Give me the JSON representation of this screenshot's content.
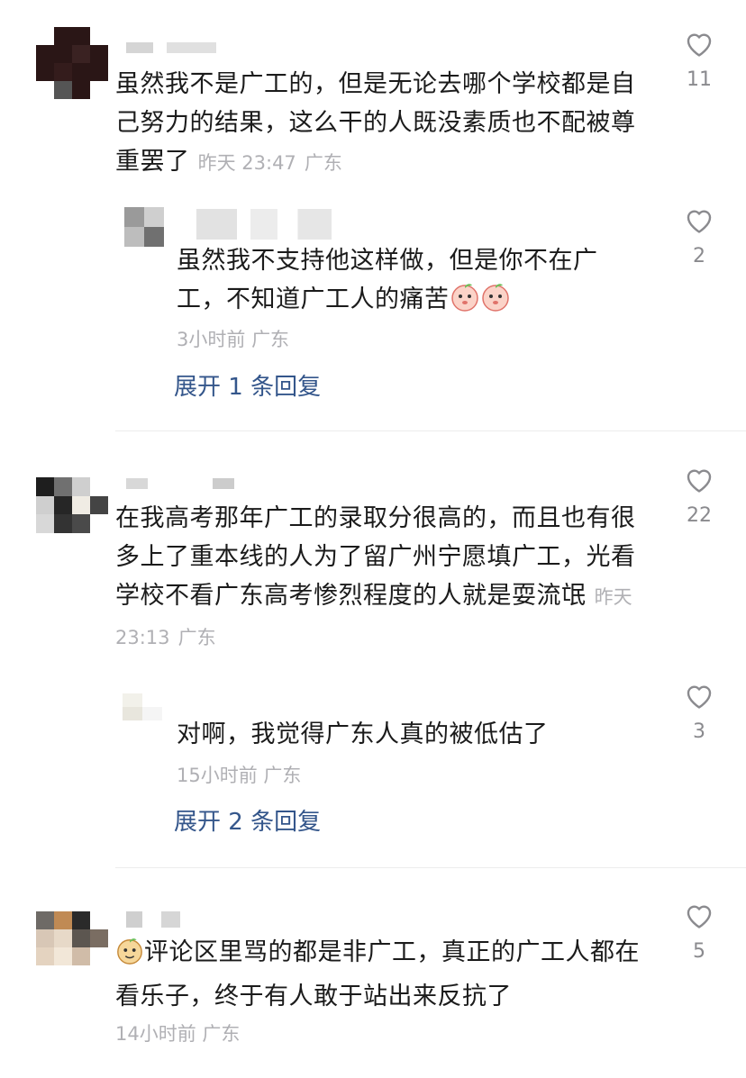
{
  "comments": [
    {
      "text": "虽然我不是广工的，但是无论去哪个学校都是自己努力的结果，这么干的人既没素质也不配被尊重罢了",
      "time": "昨天 23:47",
      "location": "广东",
      "likes": "11",
      "replies": [
        {
          "text": "虽然我不支持他这样做，但是你不在广工，不知道广工人的痛苦",
          "time": "3小时前",
          "location": "广东",
          "likes": "2"
        }
      ],
      "expand_label": "展开 1 条回复"
    },
    {
      "text": "在我高考那年广工的录取分很高的，而且也有很多上了重本线的人为了留广州宁愿填广工，光看学校不看广东高考惨烈程度的人就是耍流氓",
      "time": "昨天 23:13",
      "location": "广东",
      "likes": "22",
      "replies": [
        {
          "text": "对啊，我觉得广东人真的被低估了",
          "time": "15小时前",
          "location": "广东",
          "likes": "3"
        }
      ],
      "expand_label": "展开 2 条回复"
    },
    {
      "text": "评论区里骂的都是非广工，真正的广工人都在看乐子，终于有人敢于站出来反抗了",
      "time": "14小时前",
      "location": "广东",
      "likes": "5"
    }
  ],
  "icons": {
    "like": "heart-outline-icon",
    "emoji": "peach-emoji-icon"
  },
  "colors": {
    "text": "#1b1b1b",
    "meta": "#b0b0b4",
    "link": "#34568b"
  }
}
